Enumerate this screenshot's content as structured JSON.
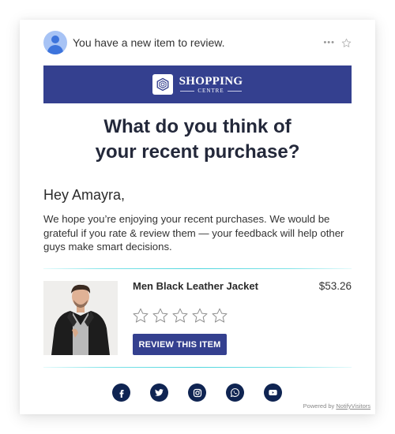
{
  "email": {
    "subject": "You have a new item to review.",
    "actions": {
      "more_icon": "more-dots-icon",
      "star_icon": "star-outline-icon"
    }
  },
  "banner": {
    "brand_main": "SHOPPING",
    "brand_sub": "CENTRE",
    "logo_icon": "hexagon-logo-icon",
    "background_color": "#34408f"
  },
  "content": {
    "title_line1": "What do you think of",
    "title_line2": "your recent purchase?",
    "greeting": "Hey Amayra,",
    "body": "We hope you’re enjoying your recent purchases. We would be grateful if you rate & review them — your feedback will help other guys make smart decisions."
  },
  "product": {
    "name": "Men Black Leather Jacket",
    "price": "$53.26",
    "rating": {
      "value": 0,
      "max": 5
    },
    "image_alt": "Man wearing black leather jacket over grey t-shirt",
    "review_button": "REVIEW THIS ITEM"
  },
  "social": [
    {
      "name": "facebook",
      "icon": "facebook-icon"
    },
    {
      "name": "twitter",
      "icon": "twitter-icon"
    },
    {
      "name": "instagram",
      "icon": "instagram-icon"
    },
    {
      "name": "whatsapp",
      "icon": "whatsapp-icon"
    },
    {
      "name": "youtube",
      "icon": "youtube-icon"
    }
  ],
  "footer": {
    "powered_prefix": "Powered by ",
    "powered_brand": "NotifyVisitors"
  },
  "colors": {
    "accent": "#34408f",
    "social_bg": "#0f2452",
    "divider": "#4fd6de",
    "avatar": "#3d74dc"
  }
}
